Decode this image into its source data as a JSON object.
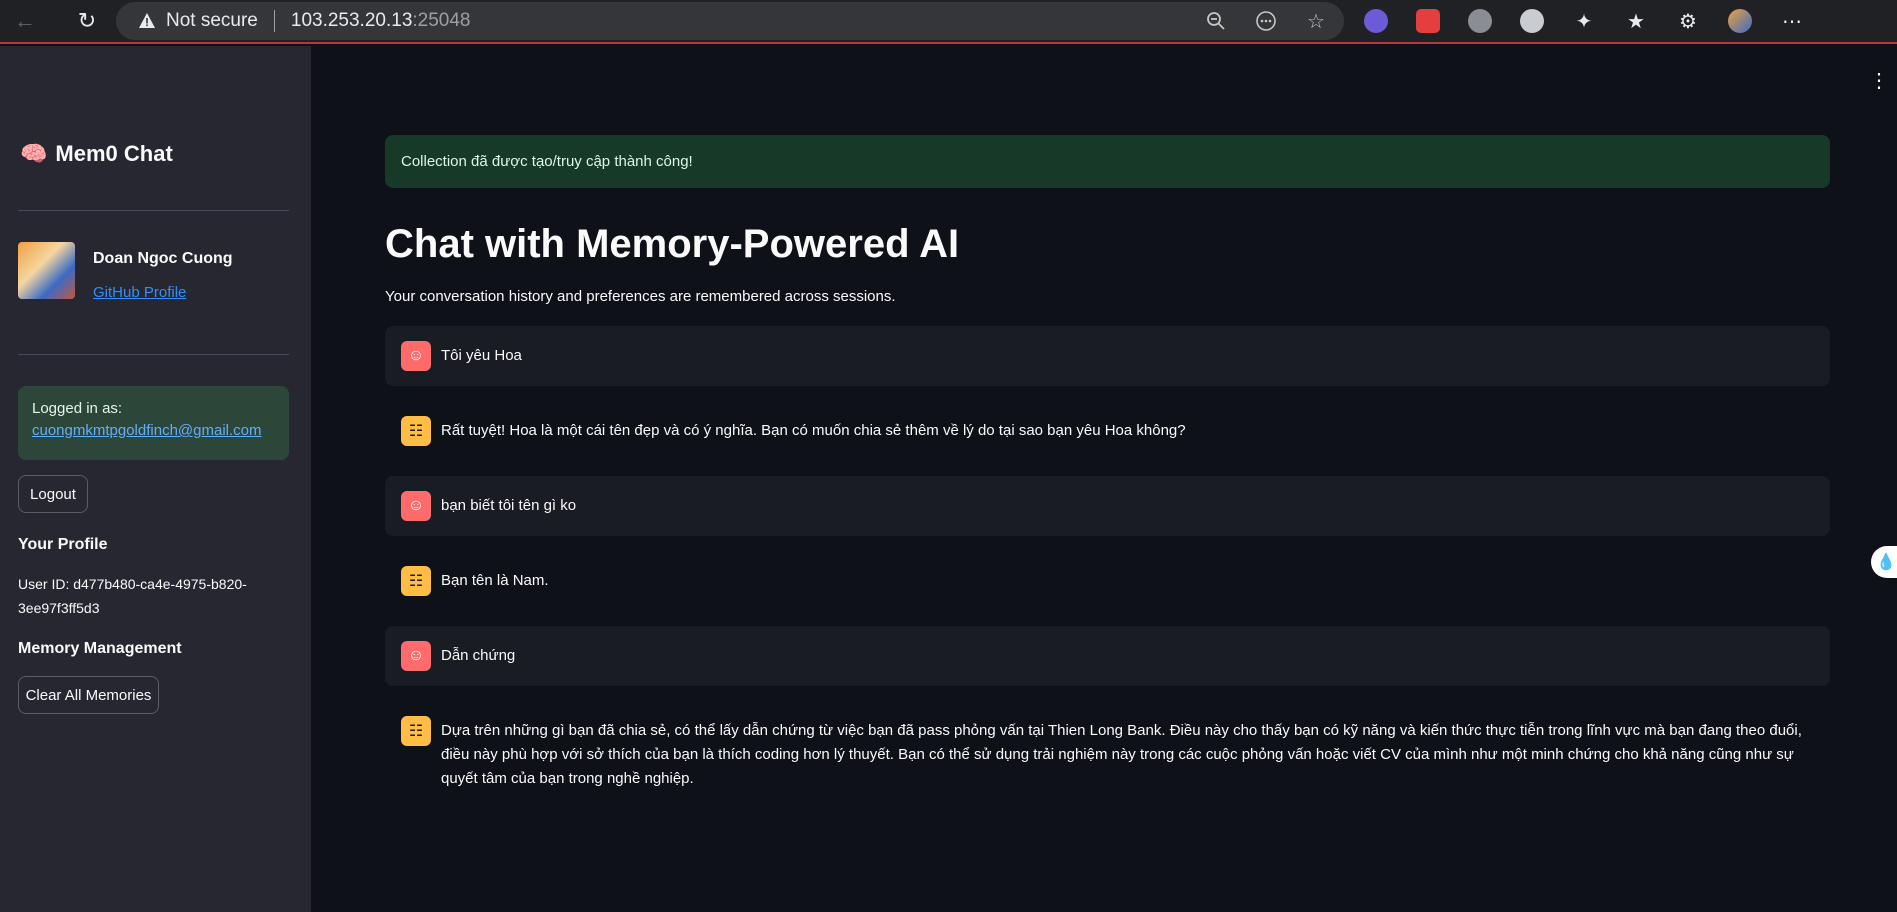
{
  "browser": {
    "not_secure": "Not secure",
    "url_host": "103.253.20.13",
    "url_port": ":25048"
  },
  "sidebar": {
    "brand": "Mem0 Chat",
    "profile_name": "Doan Ngoc Cuong",
    "profile_link": "GitHub Profile",
    "logged_label": "Logged in as:",
    "logged_email": "cuongmkmtpgoldfinch@gmail.com",
    "logout_label": "Logout",
    "your_profile_heading": "Your Profile",
    "user_id_text": "User ID: d477b480-ca4e-4975-b820-3ee97f3ff5d3",
    "memory_heading": "Memory Management",
    "clear_label": "Clear All Memories"
  },
  "main": {
    "success": "Collection đã được tạo/truy cập thành công!",
    "title": "Chat with Memory-Powered AI",
    "subtitle": "Your conversation history and preferences are remembered across sessions.",
    "messages": [
      {
        "role": "user",
        "text": "Tôi yêu Hoa"
      },
      {
        "role": "assistant",
        "text": "Rất tuyệt! Hoa là một cái tên đẹp và có ý nghĩa. Bạn có muốn chia sẻ thêm về lý do tại sao bạn yêu Hoa không?"
      },
      {
        "role": "user",
        "text": "bạn biết tôi tên gì ko"
      },
      {
        "role": "assistant",
        "text": "Bạn tên là Nam."
      },
      {
        "role": "user",
        "text": "Dẫn chứng"
      },
      {
        "role": "assistant",
        "text": "Dựa trên những gì bạn đã chia sẻ, có thể lấy dẫn chứng từ việc bạn đã pass phỏng vấn tại Thien Long Bank. Điều này cho thấy bạn có kỹ năng và kiến thức thực tiễn trong lĩnh vực mà bạn đang theo đuổi, điều này phù hợp với sở thích của bạn là thích coding hơn lý thuyết. Bạn có thể sử dụng trải nghiệm này trong các cuộc phỏng vấn hoặc viết CV của mình như một minh chứng cho khả năng cũng như sự quyết tâm của bạn trong nghề nghiệp."
      }
    ]
  },
  "colors": {
    "user_avatar": "#ff6b6b",
    "assistant_avatar": "#ffbd45",
    "success_bg": "#173928",
    "sidebar_bg": "#262730",
    "main_bg": "#0e1117"
  }
}
